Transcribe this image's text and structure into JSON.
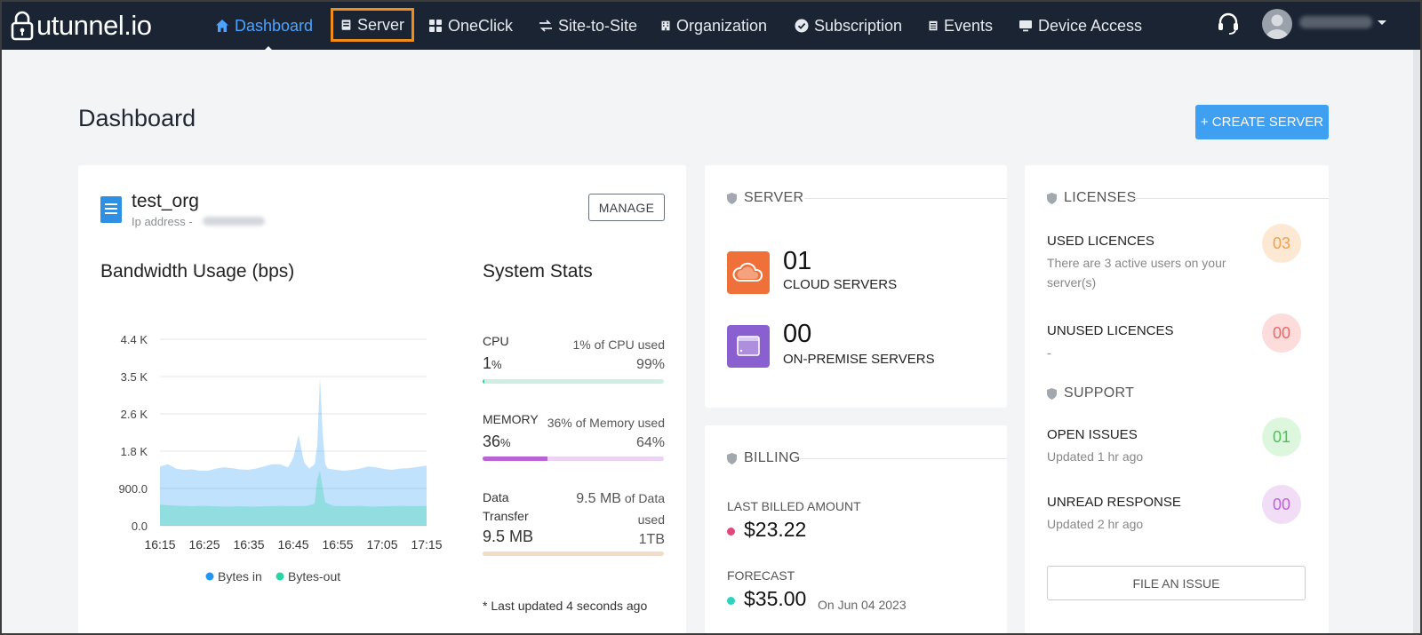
{
  "app": {
    "logo_text": "utunnel.io"
  },
  "nav": {
    "items": [
      {
        "label": "Dashboard",
        "icon": "home-icon"
      },
      {
        "label": "Server",
        "icon": "server-icon"
      },
      {
        "label": "OneClick",
        "icon": "grid-icon"
      },
      {
        "label": "Site-to-Site",
        "icon": "arrows-icon"
      },
      {
        "label": "Organization",
        "icon": "building-icon"
      },
      {
        "label": "Subscription",
        "icon": "check-circle-icon"
      },
      {
        "label": "Events",
        "icon": "document-icon"
      },
      {
        "label": "Device Access",
        "icon": "monitor-icon"
      }
    ],
    "active": "Dashboard",
    "highlighted": "Server",
    "highlight_color": "#f08c1a",
    "accent_color": "#4da3ff"
  },
  "page": {
    "title": "Dashboard",
    "create_button": "+ CREATE SERVER"
  },
  "org": {
    "name": "test_org",
    "ip_label": "Ip address -",
    "manage_button": "MANAGE"
  },
  "bandwidth": {
    "title": "Bandwidth Usage (bps)"
  },
  "chart_data": {
    "type": "area",
    "title": "Bandwidth Usage (bps)",
    "x": [
      "16:15",
      "16:25",
      "16:35",
      "16:45",
      "16:55",
      "17:05",
      "17:15"
    ],
    "y_ticks": [
      "0.0",
      "900.0",
      "1.8 K",
      "2.6 K",
      "3.5 K",
      "4.4 K"
    ],
    "ylim": [
      0,
      4400
    ],
    "grid": true,
    "legend": "bottom",
    "series": [
      {
        "name": "Bytes in",
        "color": "#2196f3",
        "points": [
          [
            0,
            1400
          ],
          [
            3,
            1450
          ],
          [
            6,
            1350
          ],
          [
            9,
            1320
          ],
          [
            12,
            1330
          ],
          [
            15,
            1300
          ],
          [
            18,
            1300
          ],
          [
            21,
            1350
          ],
          [
            24,
            1380
          ],
          [
            27,
            1360
          ],
          [
            30,
            1330
          ],
          [
            33,
            1320
          ],
          [
            36,
            1350
          ],
          [
            39,
            1400
          ],
          [
            42,
            1450
          ],
          [
            45,
            1450
          ],
          [
            48,
            1380
          ],
          [
            50,
            1600
          ],
          [
            52,
            2150
          ],
          [
            54,
            1500
          ],
          [
            56,
            1350
          ],
          [
            58,
            1450
          ],
          [
            59,
            1900
          ],
          [
            60,
            3500
          ],
          [
            61,
            2200
          ],
          [
            62,
            1450
          ],
          [
            63,
            1350
          ],
          [
            66,
            1320
          ],
          [
            69,
            1300
          ],
          [
            72,
            1320
          ],
          [
            75,
            1350
          ],
          [
            78,
            1400
          ],
          [
            81,
            1380
          ],
          [
            84,
            1340
          ],
          [
            87,
            1320
          ],
          [
            90,
            1350
          ],
          [
            93,
            1360
          ],
          [
            96,
            1380
          ],
          [
            100,
            1420
          ]
        ]
      },
      {
        "name": "Bytes-out",
        "color": "#2bd4a4",
        "points": [
          [
            0,
            500
          ],
          [
            4,
            480
          ],
          [
            8,
            470
          ],
          [
            12,
            460
          ],
          [
            16,
            470
          ],
          [
            20,
            460
          ],
          [
            25,
            450
          ],
          [
            30,
            460
          ],
          [
            35,
            450
          ],
          [
            40,
            460
          ],
          [
            45,
            470
          ],
          [
            50,
            460
          ],
          [
            55,
            470
          ],
          [
            58,
            520
          ],
          [
            59,
            1100
          ],
          [
            60,
            1300
          ],
          [
            61,
            900
          ],
          [
            62,
            550
          ],
          [
            65,
            470
          ],
          [
            70,
            460
          ],
          [
            75,
            470
          ],
          [
            80,
            450
          ],
          [
            85,
            460
          ],
          [
            90,
            470
          ],
          [
            95,
            460
          ],
          [
            100,
            470
          ]
        ]
      }
    ]
  },
  "system_stats": {
    "title": "System Stats",
    "cpu": {
      "label": "CPU",
      "value": "1",
      "unit": "%",
      "used_text": "1% of CPU used",
      "free": "99%",
      "fill": 0.01,
      "color": "#2bd4a4",
      "track": "#cfeee3"
    },
    "memory": {
      "label": "MEMORY",
      "value": "36",
      "unit": "%",
      "used_text": "36% of Memory used",
      "free": "64%",
      "fill": 0.36,
      "color": "#b864d6",
      "track": "#ecd3f4"
    },
    "data_transfer": {
      "label_line1": "Data",
      "label_line2": "Transfer",
      "value": "9.5 MB",
      "used_value": "9.5 MB",
      "used_text_1": "of Data",
      "used_text_2": "used",
      "total": "1TB",
      "fill": 0.0,
      "color": "#e59a4e",
      "track": "#f3dcc4"
    },
    "last_updated": "* Last updated 4 seconds ago"
  },
  "server": {
    "heading": "SERVER",
    "cloud": {
      "count": "01",
      "label": "CLOUD SERVERS",
      "color": "#f0703a"
    },
    "on_premise": {
      "count": "00",
      "label": "ON-PREMISE SERVERS",
      "color": "#8a5fd0"
    }
  },
  "billing": {
    "heading": "BILLING",
    "last_billed_label": "LAST BILLED AMOUNT",
    "last_billed_amount": "$23.22",
    "last_billed_color": "#e0477a",
    "forecast_label": "FORECAST",
    "forecast_amount": "$35.00",
    "forecast_date": "On Jun 04 2023",
    "forecast_color": "#2bd4bf"
  },
  "licenses": {
    "heading": "LICENSES",
    "used": {
      "title": "USED LICENCES",
      "desc": "There are 3 active users on your server(s)",
      "count": "03",
      "bg": "#fde8d4",
      "fg": "#f0a050"
    },
    "unused": {
      "title": "UNUSED LICENCES",
      "desc": "-",
      "count": "00",
      "bg": "#fddcdc",
      "fg": "#e86a6a"
    }
  },
  "support": {
    "heading": "SUPPORT",
    "open": {
      "title": "OPEN ISSUES",
      "desc": "Updated 1 hr ago",
      "count": "01",
      "bg": "#ddf7df",
      "fg": "#4fbf5a"
    },
    "unread": {
      "title": "UNREAD RESPONSE",
      "desc": "Updated 2 hr ago",
      "count": "00",
      "bg": "#f2ddf7",
      "fg": "#b864d6"
    },
    "file_issue_button": "FILE AN ISSUE"
  }
}
